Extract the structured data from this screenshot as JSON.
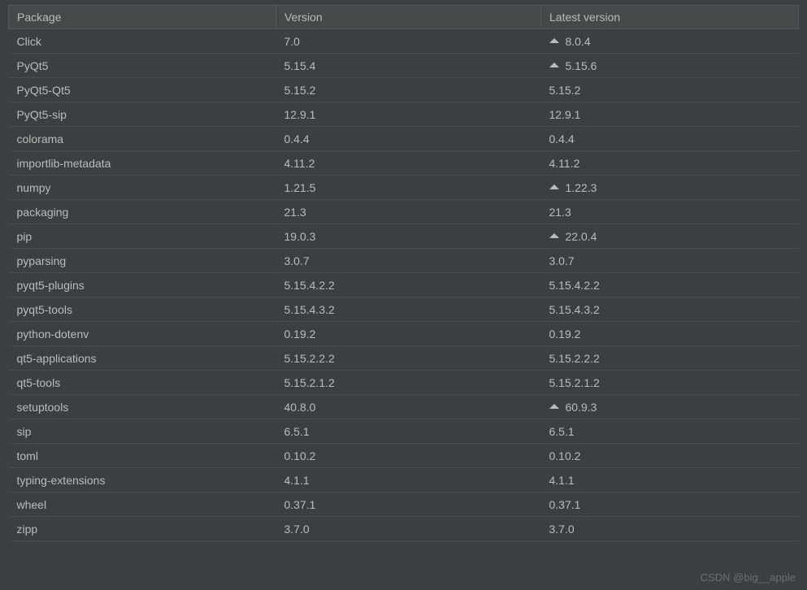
{
  "headers": {
    "package": "Package",
    "version": "Version",
    "latest": "Latest version"
  },
  "watermark": "CSDN @big__apple",
  "packages": [
    {
      "name": "Click",
      "version": "7.0",
      "latest": "8.0.4",
      "upgradable": true
    },
    {
      "name": "PyQt5",
      "version": "5.15.4",
      "latest": "5.15.6",
      "upgradable": true
    },
    {
      "name": "PyQt5-Qt5",
      "version": "5.15.2",
      "latest": "5.15.2",
      "upgradable": false
    },
    {
      "name": "PyQt5-sip",
      "version": "12.9.1",
      "latest": "12.9.1",
      "upgradable": false
    },
    {
      "name": "colorama",
      "version": "0.4.4",
      "latest": "0.4.4",
      "upgradable": false
    },
    {
      "name": "importlib-metadata",
      "version": "4.11.2",
      "latest": "4.11.2",
      "upgradable": false
    },
    {
      "name": "numpy",
      "version": "1.21.5",
      "latest": "1.22.3",
      "upgradable": true
    },
    {
      "name": "packaging",
      "version": "21.3",
      "latest": "21.3",
      "upgradable": false
    },
    {
      "name": "pip",
      "version": "19.0.3",
      "latest": "22.0.4",
      "upgradable": true
    },
    {
      "name": "pyparsing",
      "version": "3.0.7",
      "latest": "3.0.7",
      "upgradable": false
    },
    {
      "name": "pyqt5-plugins",
      "version": "5.15.4.2.2",
      "latest": "5.15.4.2.2",
      "upgradable": false
    },
    {
      "name": "pyqt5-tools",
      "version": "5.15.4.3.2",
      "latest": "5.15.4.3.2",
      "upgradable": false
    },
    {
      "name": "python-dotenv",
      "version": "0.19.2",
      "latest": "0.19.2",
      "upgradable": false
    },
    {
      "name": "qt5-applications",
      "version": "5.15.2.2.2",
      "latest": "5.15.2.2.2",
      "upgradable": false
    },
    {
      "name": "qt5-tools",
      "version": "5.15.2.1.2",
      "latest": "5.15.2.1.2",
      "upgradable": false
    },
    {
      "name": "setuptools",
      "version": "40.8.0",
      "latest": "60.9.3",
      "upgradable": true
    },
    {
      "name": "sip",
      "version": "6.5.1",
      "latest": "6.5.1",
      "upgradable": false
    },
    {
      "name": "toml",
      "version": "0.10.2",
      "latest": "0.10.2",
      "upgradable": false
    },
    {
      "name": "typing-extensions",
      "version": "4.1.1",
      "latest": "4.1.1",
      "upgradable": false
    },
    {
      "name": "wheel",
      "version": "0.37.1",
      "latest": "0.37.1",
      "upgradable": false
    },
    {
      "name": "zipp",
      "version": "3.7.0",
      "latest": "3.7.0",
      "upgradable": false
    }
  ]
}
